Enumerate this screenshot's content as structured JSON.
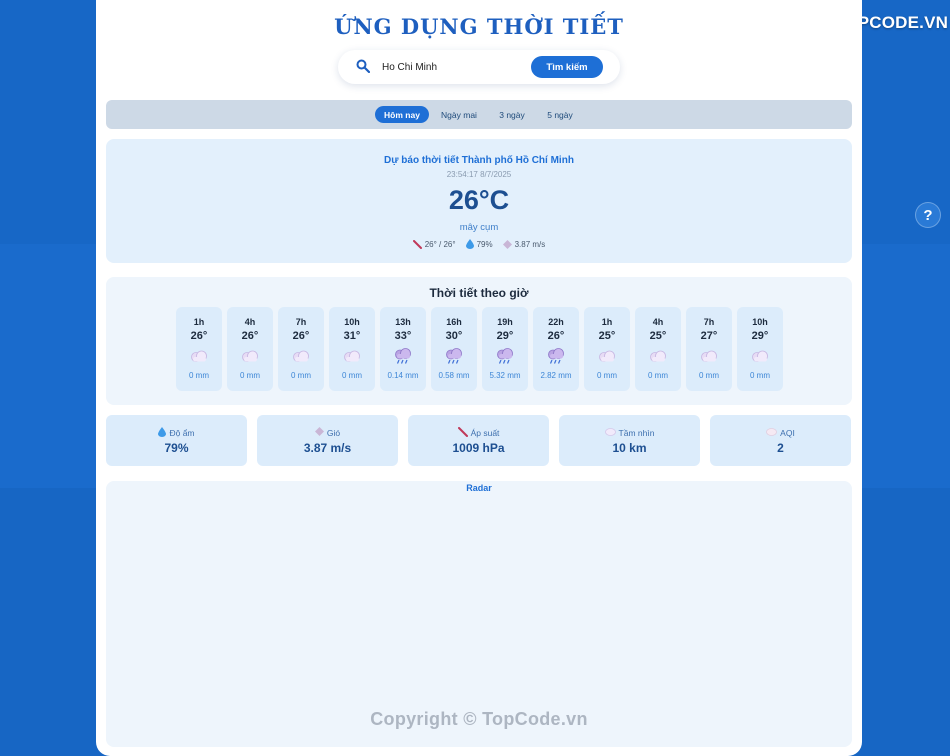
{
  "brand": {
    "name": "TOPCODE.VN"
  },
  "help": {
    "label": "?"
  },
  "app": {
    "title": "ỨNG DỤNG THỜI TIẾT"
  },
  "search": {
    "value": "Ho Chi Minh",
    "button_label": "Tìm kiếm"
  },
  "tabs": [
    {
      "label": "Hôm nay",
      "active": true
    },
    {
      "label": "Ngày mai",
      "active": false
    },
    {
      "label": "3 ngày",
      "active": false
    },
    {
      "label": "5 ngày",
      "active": false
    }
  ],
  "current": {
    "location": "Dự báo thời tiết Thành phố Hồ Chí Minh",
    "time": "23:54:17 8/7/2025",
    "temperature": "26°C",
    "description": "mây cụm",
    "range": "26° / 26°",
    "humidity": "79%",
    "wind": "3.87 m/s"
  },
  "hourly": {
    "title": "Thời tiết theo giờ",
    "items": [
      {
        "hour": "1h",
        "temp": "26°",
        "rain": "0 mm",
        "icon": "cloud-icon"
      },
      {
        "hour": "4h",
        "temp": "26°",
        "rain": "0 mm",
        "icon": "cloud-icon"
      },
      {
        "hour": "7h",
        "temp": "26°",
        "rain": "0 mm",
        "icon": "cloud-icon"
      },
      {
        "hour": "10h",
        "temp": "31°",
        "rain": "0 mm",
        "icon": "cloud-icon"
      },
      {
        "hour": "13h",
        "temp": "33°",
        "rain": "0.14 mm",
        "icon": "rain-cloud-icon"
      },
      {
        "hour": "16h",
        "temp": "30°",
        "rain": "0.58 mm",
        "icon": "rain-cloud-icon"
      },
      {
        "hour": "19h",
        "temp": "29°",
        "rain": "5.32 mm",
        "icon": "rain-cloud-icon"
      },
      {
        "hour": "22h",
        "temp": "26°",
        "rain": "2.82 mm",
        "icon": "rain-cloud-icon"
      },
      {
        "hour": "1h",
        "temp": "25°",
        "rain": "0 mm",
        "icon": "cloud-icon"
      },
      {
        "hour": "4h",
        "temp": "25°",
        "rain": "0 mm",
        "icon": "cloud-icon"
      },
      {
        "hour": "7h",
        "temp": "27°",
        "rain": "0 mm",
        "icon": "cloud-icon"
      },
      {
        "hour": "10h",
        "temp": "29°",
        "rain": "0 mm",
        "icon": "cloud-icon"
      }
    ]
  },
  "stats": [
    {
      "label": "Độ ẩm",
      "value": "79%",
      "icon": "droplet-icon"
    },
    {
      "label": "Gió",
      "value": "3.87 m/s",
      "icon": "wind-icon"
    },
    {
      "label": "Áp suất",
      "value": "1009 hPa",
      "icon": "gauge-icon"
    },
    {
      "label": "Tầm nhìn",
      "value": "10 km",
      "icon": "eye-icon"
    },
    {
      "label": "AQI",
      "value": "2",
      "icon": "air-icon"
    }
  ],
  "radar": {
    "title": "Radar"
  },
  "footer": {
    "copyright": "Copyright © TopCode.vn"
  },
  "colors": {
    "accent": "#1e6fd6",
    "background": "#1767c6",
    "panel": "#e3f0fc"
  }
}
